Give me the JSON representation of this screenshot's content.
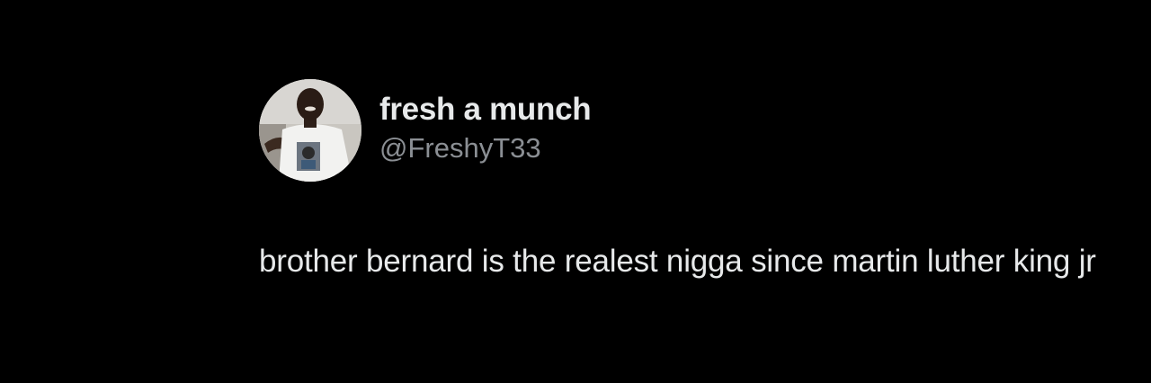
{
  "tweet": {
    "author": {
      "display_name": "fresh a munch",
      "handle": "@FreshyT33",
      "avatar_icon": "profile-photo"
    },
    "text": "brother bernard is the realest nigga since martin luther king jr"
  },
  "colors": {
    "background": "#000000",
    "primary_text": "#e7e9ea",
    "secondary_text": "#8b8f94"
  }
}
